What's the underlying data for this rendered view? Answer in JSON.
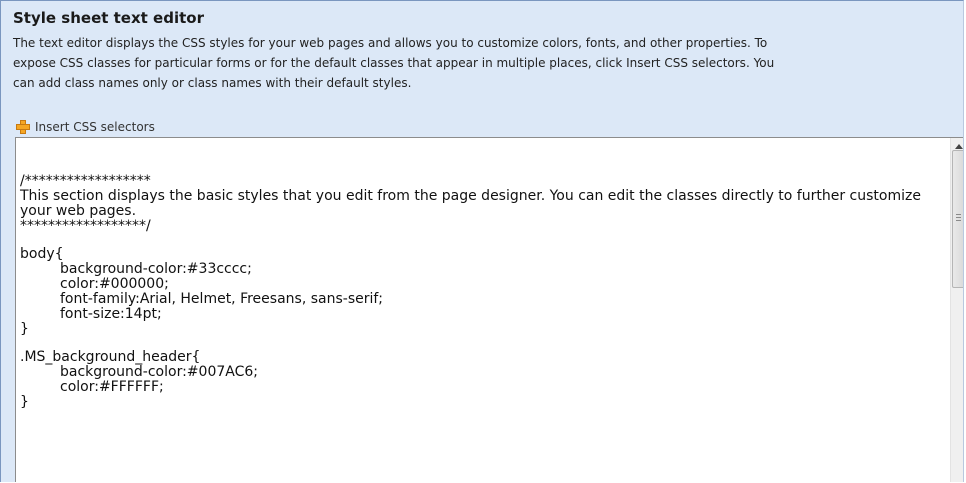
{
  "title": "Style sheet text editor",
  "description_lines": [
    "The text editor displays the CSS styles for your web pages and allows you to customize colors, fonts, and other properties. To",
    "expose CSS classes for particular forms or for the default classes that appear in multiple places, click Insert CSS selectors. You",
    "can add class names only or class names with their default styles."
  ],
  "toolbar": {
    "icon": "plus-icon",
    "insert_label": "Insert CSS selectors"
  },
  "editor": {
    "comment_open": "/******************",
    "comment_text": "This section displays the basic styles that you edit from the page designer. You can edit the classes directly to further customize your web pages.",
    "comment_close": "******************/",
    "body_selector": "body{",
    "body_props": [
      "background-color:#33cccc;",
      "color:#000000;",
      "font-family:Arial, Helmet, Freesans, sans-serif;",
      "font-size:14pt;"
    ],
    "body_close": "}",
    "header_selector": ".MS_background_header{",
    "header_props": [
      "background-color:#007AC6;",
      "color:#FFFFFF;"
    ],
    "header_close": "}"
  },
  "colors": {
    "panel_bg": "#dce8f7",
    "icon_orange": "#f0a030"
  }
}
